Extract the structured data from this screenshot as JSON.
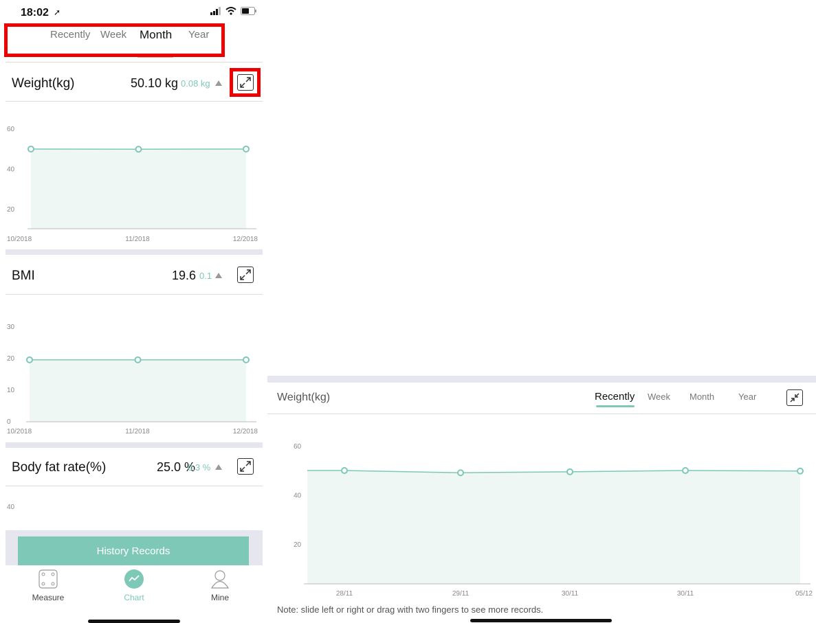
{
  "status": {
    "time": "18:02"
  },
  "periods": {
    "tabs": [
      {
        "label": "Recently",
        "active": false
      },
      {
        "label": "Week",
        "active": false
      },
      {
        "label": "Month",
        "active": true
      },
      {
        "label": "Year",
        "active": false
      }
    ]
  },
  "metrics": {
    "weight": {
      "title": "Weight(kg)",
      "value": "50.10 kg",
      "delta": "0.08 kg"
    },
    "bmi": {
      "title": "BMI",
      "value": "19.6",
      "delta": "0.1"
    },
    "fat": {
      "title": "Body fat rate(%)",
      "value": "25.0 %",
      "delta": "0.3 %"
    }
  },
  "history_button": "History Records",
  "tabbar": [
    {
      "label": "Measure",
      "icon": "scale-icon",
      "active": false
    },
    {
      "label": "Chart",
      "icon": "chart-icon",
      "active": true
    },
    {
      "label": "Mine",
      "icon": "person-icon",
      "active": false
    }
  ],
  "landscape": {
    "title": "Weight(kg)",
    "tabs": [
      {
        "label": "Recently",
        "active": true
      },
      {
        "label": "Week",
        "active": false
      },
      {
        "label": "Month",
        "active": false
      },
      {
        "label": "Year",
        "active": false
      }
    ],
    "note": "Note: slide left or right or drag with two fingers to see more records."
  },
  "colors": {
    "accent": "#7ec8b8",
    "area": "#eef7f4",
    "highlight": "#ee0000"
  },
  "chart_data": [
    {
      "type": "area",
      "categories": [
        "10/2018",
        "11/2018",
        "12/2018"
      ],
      "values": [
        50.1,
        50.0,
        50.1
      ],
      "yticks": [
        20,
        40,
        60
      ],
      "ylim": [
        10,
        60
      ]
    },
    {
      "type": "area",
      "categories": [
        "10/2018",
        "11/2018",
        "12/2018"
      ],
      "values": [
        19.6,
        19.6,
        19.6
      ],
      "yticks": [
        0,
        10,
        20,
        30
      ],
      "ylim": [
        0,
        30
      ]
    },
    {
      "type": "area",
      "yticks": [
        40
      ]
    },
    {
      "type": "area",
      "categories": [
        "28/11",
        "29/11",
        "30/11",
        "30/11",
        "05/12"
      ],
      "values": [
        50.2,
        49.3,
        49.7,
        50.2,
        50.0
      ],
      "yticks": [
        20,
        40,
        60
      ],
      "ylim": [
        10,
        60
      ]
    }
  ]
}
